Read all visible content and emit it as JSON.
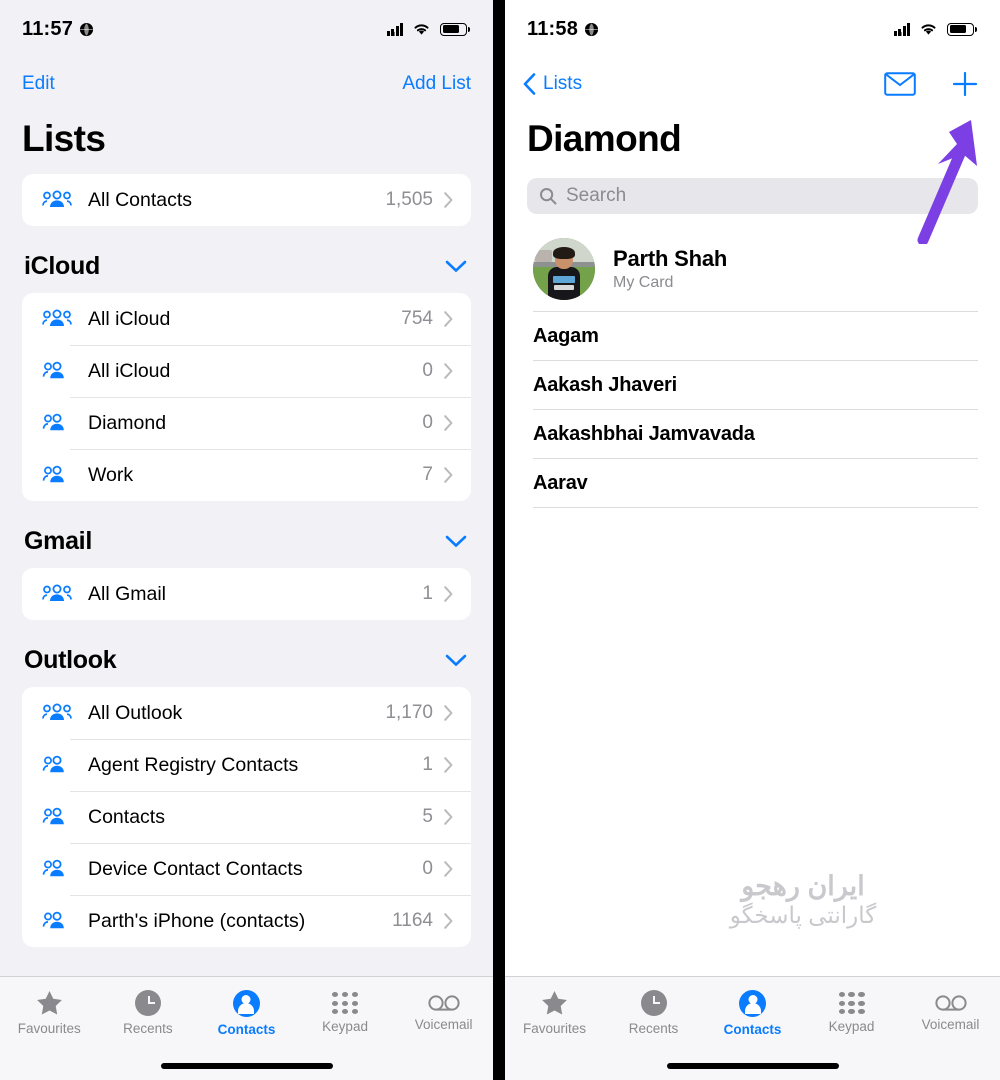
{
  "left": {
    "status": {
      "time": "11:57",
      "globe_icon": "globe-icon",
      "signal_icon": "cellular-signal-icon",
      "wifi_icon": "wifi-icon",
      "battery_icon": "battery-icon"
    },
    "nav": {
      "edit_label": "Edit",
      "add_list_label": "Add List"
    },
    "title": "Lists",
    "top_card": [
      {
        "icon": "three-people-icon",
        "label": "All Contacts",
        "count": "1,505"
      }
    ],
    "groups": [
      {
        "name": "iCloud",
        "chevron_icon": "chevron-down-icon",
        "items": [
          {
            "icon": "three-people-icon",
            "label": "All iCloud",
            "count": "754"
          },
          {
            "icon": "two-people-icon",
            "label": "All iCloud",
            "count": "0"
          },
          {
            "icon": "two-people-icon",
            "label": "Diamond",
            "count": "0"
          },
          {
            "icon": "two-people-icon",
            "label": "Work",
            "count": "7"
          }
        ]
      },
      {
        "name": "Gmail",
        "chevron_icon": "chevron-down-icon",
        "items": [
          {
            "icon": "three-people-icon",
            "label": "All Gmail",
            "count": "1"
          }
        ]
      },
      {
        "name": "Outlook",
        "chevron_icon": "chevron-down-icon",
        "items": [
          {
            "icon": "three-people-icon",
            "label": "All Outlook",
            "count": "1,170"
          },
          {
            "icon": "two-people-icon",
            "label": "Agent Registry Contacts",
            "count": "1"
          },
          {
            "icon": "two-people-icon",
            "label": "Contacts",
            "count": "5"
          },
          {
            "icon": "two-people-icon",
            "label": "Device Contact Contacts",
            "count": "0"
          },
          {
            "icon": "two-people-icon",
            "label": "Parth's iPhone (contacts)",
            "count": "1164"
          }
        ]
      }
    ]
  },
  "right": {
    "status": {
      "time": "11:58",
      "globe_icon": "globe-icon",
      "signal_icon": "cellular-signal-icon",
      "wifi_icon": "wifi-icon",
      "battery_icon": "battery-icon"
    },
    "nav": {
      "back_label": "Lists",
      "back_icon": "chevron-left-icon",
      "mail_icon": "envelope-icon",
      "add_icon": "plus-icon"
    },
    "title": "Diamond",
    "search": {
      "placeholder": "Search",
      "icon": "search-icon"
    },
    "my_card": {
      "name": "Parth Shah",
      "subtitle": "My Card",
      "avatar": "contact-photo"
    },
    "contacts": [
      {
        "name": "Aagam"
      },
      {
        "name": "Aakash Jhaveri"
      },
      {
        "name": "Aakashbhai Jamvavada"
      },
      {
        "name": "Aarav"
      }
    ]
  },
  "tabbar": {
    "items": [
      {
        "label": "Favourites",
        "icon": "star-icon",
        "active": false
      },
      {
        "label": "Recents",
        "icon": "clock-icon",
        "active": false
      },
      {
        "label": "Contacts",
        "icon": "person-icon",
        "active": true
      },
      {
        "label": "Keypad",
        "icon": "keypad-icon",
        "active": false
      },
      {
        "label": "Voicemail",
        "icon": "voicemail-icon",
        "active": false
      }
    ]
  },
  "annotation": {
    "arrow_icon": "pointer-arrow",
    "color": "#7b3fe4"
  },
  "watermark": {
    "line1": "ایران رهجو",
    "line2": "گارانتی پاسخگو"
  },
  "colors": {
    "accent": "#0a7cff",
    "page_bg": "#f1f1f6",
    "card_bg": "#ffffff",
    "secondary_text": "#8e8e93"
  }
}
